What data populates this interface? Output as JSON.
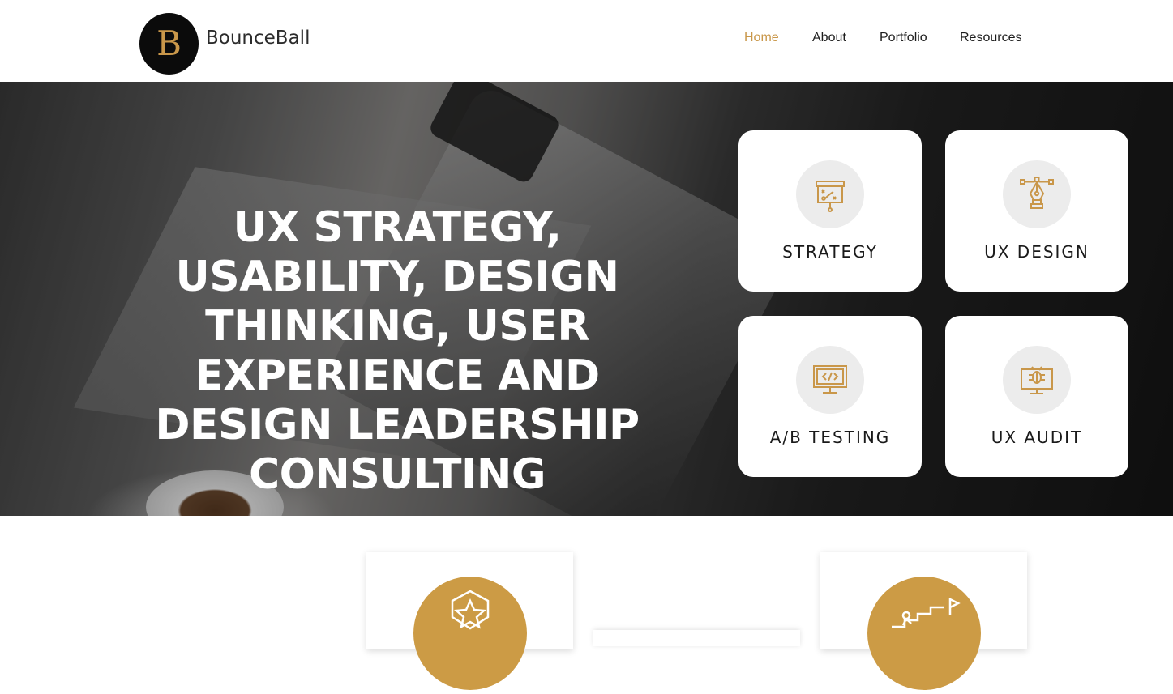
{
  "header": {
    "logo_letter": "B",
    "brand": "BounceBall",
    "nav": [
      {
        "label": "Home",
        "active": true
      },
      {
        "label": "About",
        "active": false
      },
      {
        "label": "Portfolio",
        "active": false
      },
      {
        "label": "Resources",
        "active": false
      }
    ]
  },
  "hero": {
    "headline": "UX STRATEGY,  USABILITY, DESIGN THINKING, USER EXPERIENCE AND DESIGN LEADERSHIP CONSULTING",
    "cards": [
      {
        "label": "STRATEGY",
        "icon": "strategy-board-icon"
      },
      {
        "label": "UX DESIGN",
        "icon": "pen-tool-icon"
      },
      {
        "label": "A/B TESTING",
        "icon": "code-monitor-icon"
      },
      {
        "label": "UX AUDIT",
        "icon": "bug-monitor-icon"
      }
    ]
  },
  "colors": {
    "accent": "#c9974a",
    "gold_circle": "#cc9b45",
    "card_icon_bg": "#ececec"
  }
}
